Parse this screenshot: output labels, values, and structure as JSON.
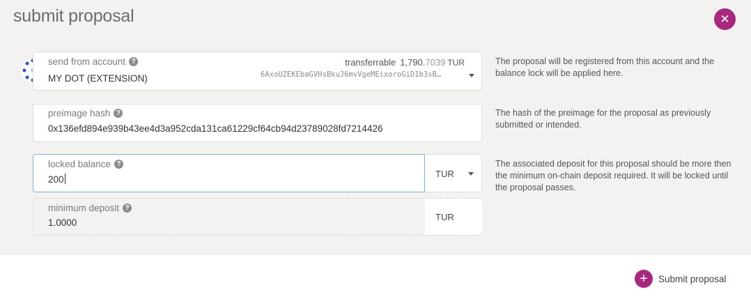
{
  "modal": {
    "title": "submit proposal",
    "close_icon": "✕"
  },
  "account": {
    "label": "send from account",
    "name": "MY DOT (EXTENSION)",
    "transferable_label": "transferrable",
    "transferable_int": "1,790.",
    "transferable_dec": "7039",
    "transferable_unit": "TUR",
    "address": "6AxoUZEKEbaGVHsBkuJ6mvVgeMEixoroGiD1b3sB…",
    "hint": "The proposal will be registered from this account and the balance lock will be applied here."
  },
  "preimage": {
    "label": "preimage hash",
    "value": "0x136efd894e939b43ee4d3a952cda131ca61229cf64cb94d23789028fd7214426",
    "hint": "The hash of the preimage for the proposal as previously submitted or intended."
  },
  "locked_balance": {
    "label": "locked balance",
    "value": "200",
    "unit": "TUR",
    "hint": "The associated deposit for this proposal should be more then the minimum on-chain deposit required. It will be locked until the proposal passes."
  },
  "minimum_deposit": {
    "label": "minimum deposit",
    "value": "1.0000",
    "unit": "TUR"
  },
  "actions": {
    "submit_label": "Submit proposal",
    "submit_icon": "+"
  },
  "icons": {
    "help": "?"
  },
  "colors": {
    "accent": "#a9287f",
    "modal_bg": "#f3f2f1",
    "focus_border": "#7fb3d8"
  }
}
